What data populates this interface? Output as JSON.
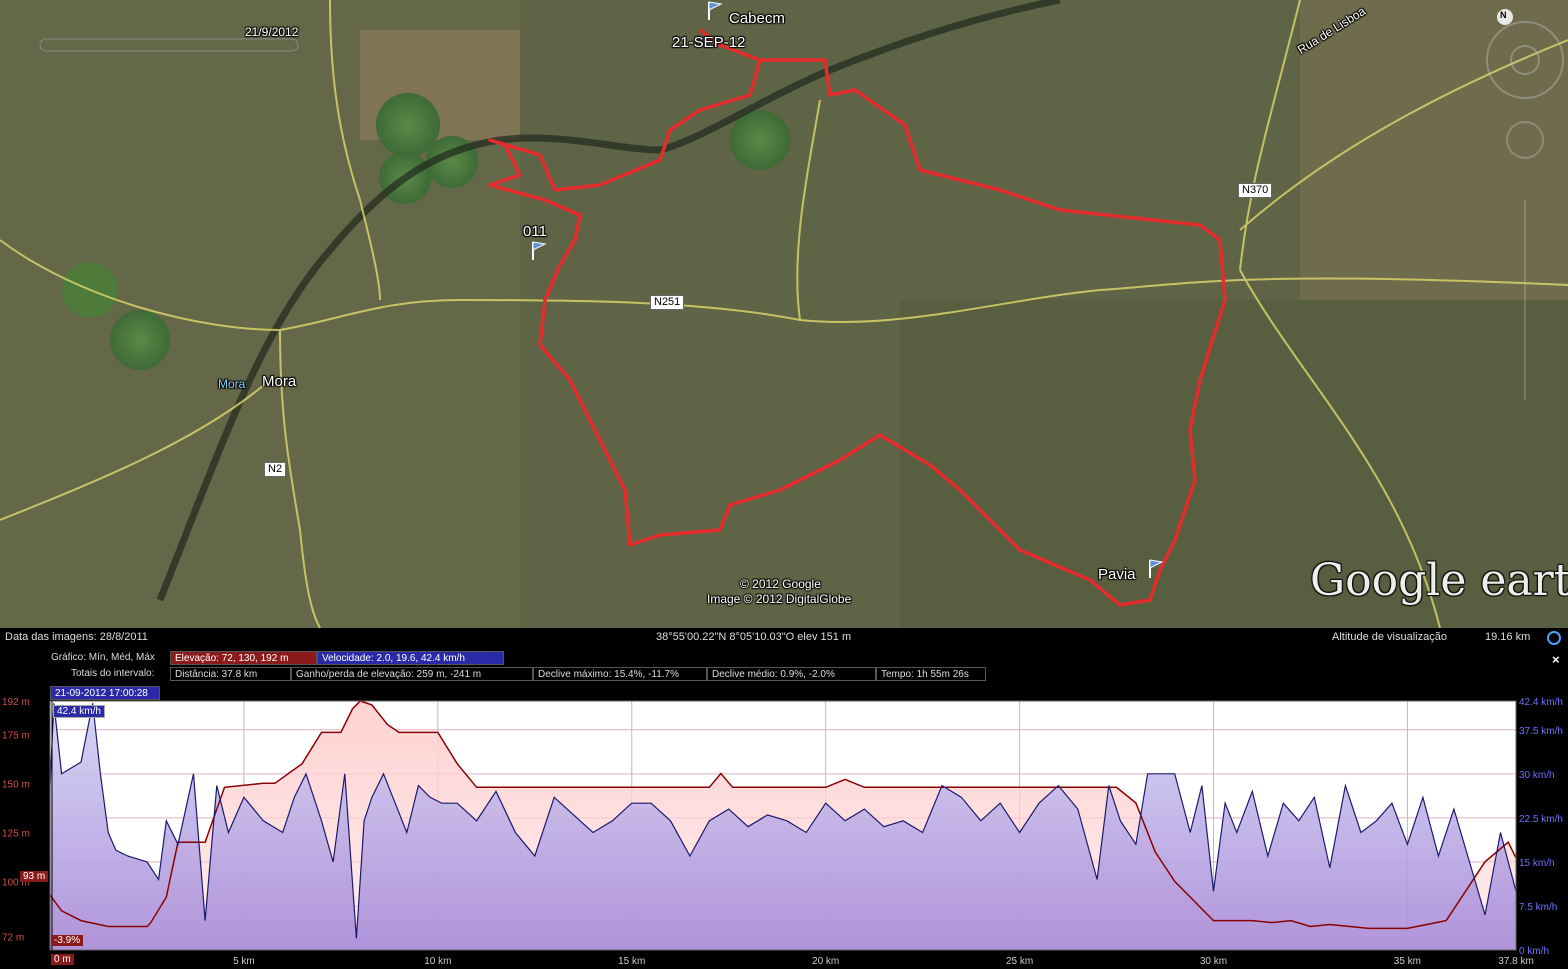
{
  "map": {
    "places": {
      "cabecm": "Cabecm",
      "cabecm_date": "21-SEP-12",
      "waypoint": "011",
      "mora_small": "Mora",
      "mora": "Mora",
      "pavia": "Pavia"
    },
    "roads": {
      "n251": "N251",
      "n370": "N370",
      "n2": "N2",
      "rua_lisboa": "Rua de Lisboa"
    },
    "timeslider_date": "21/9/2012",
    "copyright_1": "© 2012 Google",
    "copyright_2": "Image © 2012 DigitalGlobe",
    "brand": "Google earth",
    "compass_n": "N",
    "colors": {
      "track": "#e52b2b",
      "road": "#d8d26a"
    }
  },
  "status": {
    "image_date": "Data das imagens: 28/8/2011",
    "coords": "38°55'00.22\"N   8°05'10.03\"O  elev   151 m",
    "view_alt": "Altitude de visualização",
    "view_alt_val": "19.16 km"
  },
  "profile": {
    "row1_label": "Gráfico: Mín, Méd, Máx",
    "elev_box": "Elevação: 72, 130, 192 m",
    "speed_box": "Velocidade: 2.0, 19.6, 42.4 km/h",
    "row2_label": "Totais do intervalo:",
    "dist_box": "Distância: 37.8 km",
    "gain_box": "Ganho/perda de elevação: 259 m, -241 m",
    "maxslope_box": "Declive máximo: 15.4%, -11.7%",
    "avgslope_box": "Declive médio: 0.9%, -2.0%",
    "time_box": "Tempo: 1h 55m 26s",
    "cursor_time": "21-09-2012 17:00:28",
    "cursor_speed": "42.4 km/h",
    "cursor_elev": "93 m",
    "cursor_slope": "-3.9%",
    "cursor_dist": "0 m",
    "close": "×"
  },
  "chart_data": {
    "type": "area",
    "xlabel": "",
    "ylabel": "",
    "x_ticks": [
      "5 km",
      "10 km",
      "15 km",
      "20 km",
      "25 km",
      "30 km",
      "35 km",
      "37.8 km"
    ],
    "x_tick_values": [
      5,
      10,
      15,
      20,
      25,
      30,
      35,
      37.8
    ],
    "y_left_ticks": [
      "192 m",
      "175 m",
      "150 m",
      "125 m",
      "100 m",
      "72 m"
    ],
    "y_left_values": [
      192,
      175,
      150,
      125,
      100,
      72
    ],
    "y_right_ticks": [
      "42.4 km/h",
      "37.5 km/h",
      "30 km/h",
      "22.5 km/h",
      "15 km/h",
      "7.5 km/h",
      "0 km/h"
    ],
    "y_right_values": [
      42.4,
      37.5,
      30,
      22.5,
      15,
      7.5,
      0
    ],
    "xlim": [
      0,
      37.8
    ],
    "ylim_elev": [
      65,
      192
    ],
    "ylim_speed": [
      0,
      42.4
    ],
    "series": [
      {
        "name": "Elevação",
        "unit": "m",
        "color": "#8b0000",
        "x": [
          0,
          0.3,
          0.8,
          1.5,
          2.5,
          2.6,
          3,
          3.3,
          4,
          4.5,
          5.5,
          5.8,
          6.5,
          7,
          7.5,
          7.8,
          8,
          8.3,
          8.7,
          9,
          9.3,
          9.5,
          10,
          10.5,
          11,
          11.5,
          12,
          13,
          14,
          15,
          17,
          17.3,
          17.6,
          20,
          20.5,
          21,
          22,
          24,
          25,
          26,
          27,
          27.5,
          28,
          28.5,
          29,
          30,
          31,
          31.5,
          32,
          32.5,
          33,
          34,
          35,
          35.5,
          36,
          37,
          37.3,
          37.6,
          37.8
        ],
        "y": [
          93,
          85,
          80,
          77,
          77,
          79,
          92,
          120,
          120,
          148,
          150,
          150,
          160,
          176,
          176,
          188,
          192,
          190,
          180,
          176,
          176,
          176,
          176,
          160,
          148,
          148,
          148,
          148,
          148,
          148,
          148,
          155,
          148,
          148,
          152,
          148,
          148,
          148,
          148,
          148,
          148,
          148,
          140,
          115,
          100,
          80,
          80,
          79,
          80,
          77,
          78,
          76,
          76,
          78,
          80,
          110,
          115,
          120,
          112
        ]
      },
      {
        "name": "Velocidade",
        "unit": "km/h",
        "color": "#1a1a6e",
        "x": [
          0,
          0.1,
          0.3,
          0.8,
          1.1,
          1.3,
          1.5,
          1.7,
          2,
          2.5,
          2.8,
          3,
          3.3,
          3.7,
          4,
          4.3,
          4.6,
          5,
          5.5,
          6,
          6.3,
          6.6,
          7,
          7.3,
          7.6,
          7.9,
          8.1,
          8.3,
          8.6,
          8.9,
          9.2,
          9.5,
          9.8,
          10.1,
          10.5,
          11,
          11.5,
          12,
          12.5,
          13,
          13.5,
          14,
          14.5,
          15,
          15.5,
          16,
          16.5,
          17,
          17.5,
          18,
          18.5,
          19,
          19.5,
          20,
          20.5,
          21,
          21.5,
          22,
          22.5,
          23,
          23.5,
          24,
          24.5,
          25,
          25.5,
          26,
          26.5,
          27,
          27.3,
          27.6,
          28,
          28.3,
          28.6,
          29,
          29.4,
          29.7,
          30,
          30.3,
          30.6,
          31,
          31.4,
          31.8,
          32.2,
          32.6,
          33,
          33.4,
          33.8,
          34.2,
          34.6,
          35,
          35.4,
          35.8,
          36.2,
          36.6,
          37,
          37.4,
          37.8
        ],
        "y": [
          28,
          42,
          30,
          32,
          42,
          30,
          20,
          17,
          16,
          15,
          12,
          22,
          18,
          30,
          5,
          28,
          20,
          26,
          22,
          20,
          26,
          30,
          22,
          15,
          30,
          2,
          22,
          26,
          30,
          25,
          20,
          28,
          26,
          25,
          25,
          22,
          27,
          20,
          16,
          26,
          23,
          20,
          22,
          25,
          25,
          22,
          16,
          22,
          24,
          21,
          23,
          22,
          20,
          25,
          22,
          24,
          21,
          22,
          20,
          28,
          26,
          22,
          25,
          20,
          25,
          28,
          24,
          12,
          28,
          22,
          18,
          30,
          30,
          30,
          20,
          28,
          10,
          25,
          20,
          27,
          16,
          25,
          22,
          26,
          14,
          28,
          20,
          22,
          25,
          18,
          26,
          16,
          24,
          15,
          6,
          20,
          10
        ]
      }
    ]
  }
}
